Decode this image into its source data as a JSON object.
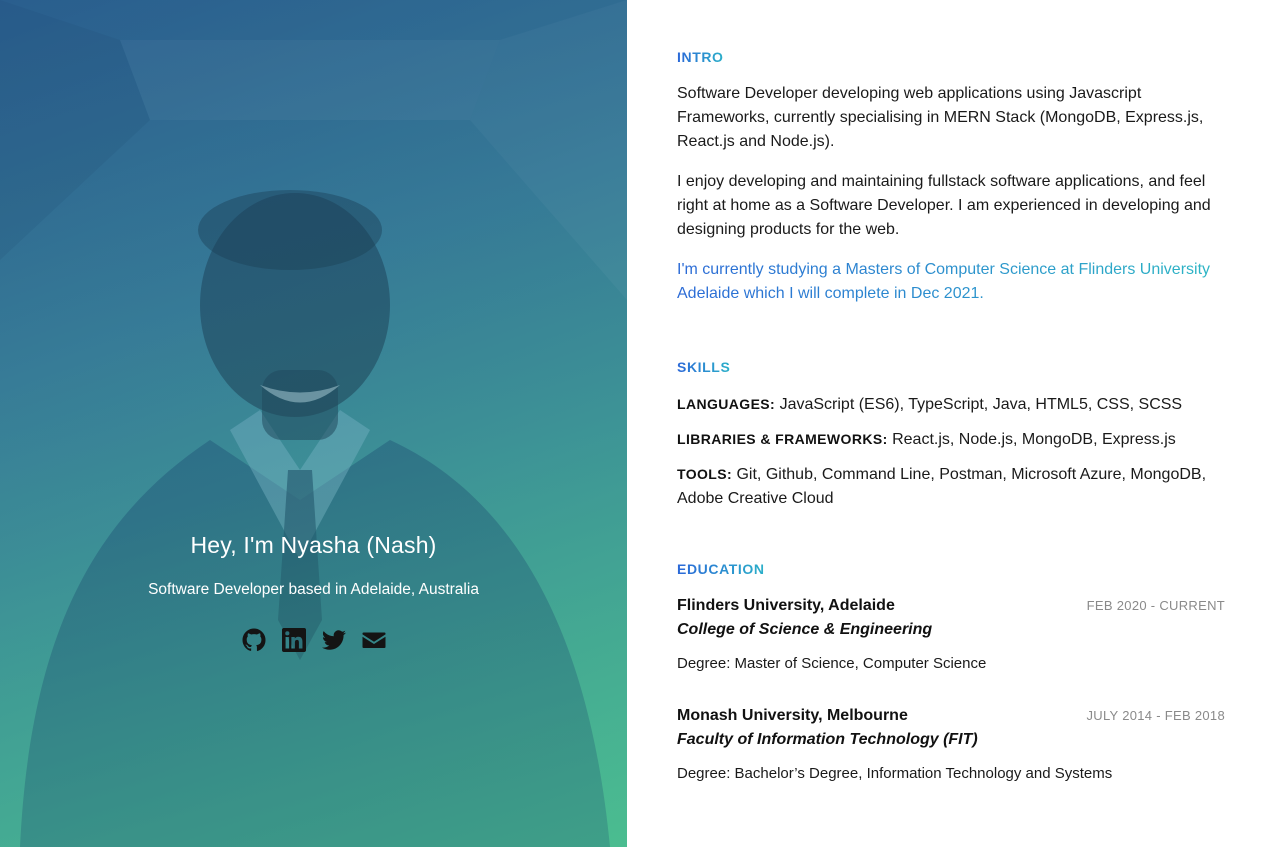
{
  "hero": {
    "title": "Hey, I'm Nyasha (Nash)",
    "subtitle": "Software Developer based in Adelaide, Australia",
    "socials": [
      {
        "icon": "github-icon"
      },
      {
        "icon": "linkedin-icon"
      },
      {
        "icon": "twitter-icon"
      },
      {
        "icon": "email-icon"
      }
    ],
    "gradient_colors": [
      "#2c5d8a",
      "#3f9a95",
      "#4bbb8f"
    ]
  },
  "intro": {
    "heading": "INTRO",
    "p1": "Software Developer developing web applications using Javascript Frameworks, currently specialising in MERN Stack (MongoDB, Express.js, React.js and Node.js).",
    "p2": "I enjoy developing and maintaining fullstack software applications, and feel right at home as a Software Developer. I am experienced in developing and designing products for the web.",
    "p3": "I'm currently studying a Masters of Computer Science at Flinders University Adelaide which I will complete in Dec 2021."
  },
  "skills": {
    "heading": "SKILLS",
    "rows": [
      {
        "label": "LANGUAGES:",
        "value": "JavaScript (ES6), TypeScript, Java, HTML5, CSS, SCSS"
      },
      {
        "label": "LIBRARIES & FRAMEWORKS:",
        "value": "React.js, Node.js, MongoDB, Express.js"
      },
      {
        "label": "TOOLS:",
        "value": "Git, Github, Command Line, Postman, Microsoft Azure, MongoDB, Adobe Creative Cloud"
      }
    ]
  },
  "education": {
    "heading": "EDUCATION",
    "items": [
      {
        "name": "Flinders University, Adelaide",
        "dates": "FEB 2020 - CURRENT",
        "faculty": "College of Science & Engineering",
        "degree_label": "Degree:",
        "degree": "Master of Science, Computer Science"
      },
      {
        "name": "Monash University, Melbourne",
        "dates": "JULY 2014 - FEB 2018",
        "faculty": "Faculty of Information Technology (FIT)",
        "degree_label": "Degree:",
        "degree": "Bachelor’s Degree, Information Technology and Systems"
      }
    ]
  },
  "colors": {
    "accent_start": "#2b68d8",
    "accent_end": "#2bb0c9",
    "date_gray": "#8a8a8a"
  }
}
